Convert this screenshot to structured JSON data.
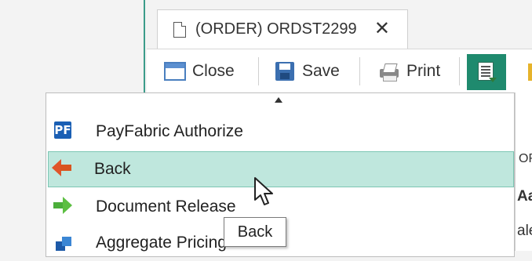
{
  "tab": {
    "title": "(ORDER) ORDST2299",
    "close_glyph": "✕"
  },
  "toolbar": {
    "close_label": "Close",
    "save_label": "Save",
    "print_label": "Print",
    "active_icon": "document-list-icon",
    "active_color": "#1f8a6e"
  },
  "menu": {
    "items": [
      {
        "label": "PayFabric Authorize",
        "icon": "payfabric-icon"
      },
      {
        "label": "Back",
        "icon": "arrow-left-icon",
        "hovered": true
      },
      {
        "label": "Document Release",
        "icon": "arrow-right-icon"
      },
      {
        "label": "Aggregate Pricing",
        "icon": "aggregate-icon"
      }
    ],
    "hover_color": "#bfe7dd"
  },
  "tooltip": {
    "text": "Back"
  },
  "right_panel": {
    "line1": "ORDER",
    "line2": "Aa",
    "line3": "ale"
  }
}
